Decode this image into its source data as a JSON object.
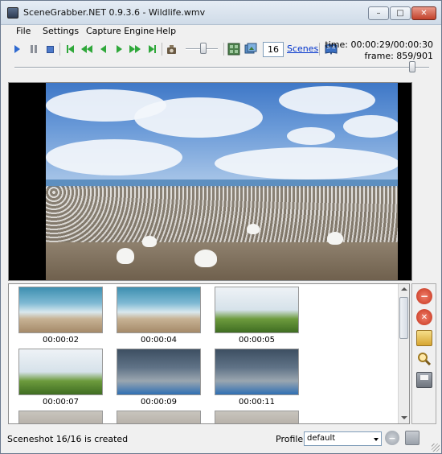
{
  "window": {
    "title": "SceneGrabber.NET 0.9.3.6  - Wildlife.wmv",
    "app_icon": "camera-app-icon",
    "controls": {
      "minimize": "–",
      "maximize": "□",
      "close": "✕"
    }
  },
  "menu": {
    "items": [
      "File",
      "Settings",
      "Capture Engine",
      "Help"
    ]
  },
  "toolbar": {
    "scene_count": "16",
    "scenes_link": "Scenes",
    "time": "time: 00:00:29/00:00:30",
    "frame": "frame: 859/901",
    "volume_level": 0.55,
    "position_level": 0.96,
    "colors": {
      "play": "#2f6ad0",
      "nav": "#2fa83a"
    }
  },
  "thumbnails": [
    {
      "time": "00:00:02",
      "scene": "horses"
    },
    {
      "time": "00:00:04",
      "scene": "horses"
    },
    {
      "time": "00:00:05",
      "scene": "birds-grass"
    },
    {
      "time": "00:00:07",
      "scene": "birds-grass"
    },
    {
      "time": "00:00:09",
      "scene": "seals"
    },
    {
      "time": "00:00:11",
      "scene": "seals"
    },
    {
      "time": "",
      "scene": "gannets"
    },
    {
      "time": "",
      "scene": "gannets"
    },
    {
      "time": "",
      "scene": "gannets"
    }
  ],
  "side_actions": {
    "remove": "minus-icon",
    "clear": "x-icon",
    "open": "folder-icon",
    "zoom": "magnifier-icon",
    "save": "floppy-icon"
  },
  "status": {
    "message": "Sceneshot 16/16 is created",
    "profile_label": "Profile:",
    "profile_value": "default"
  }
}
